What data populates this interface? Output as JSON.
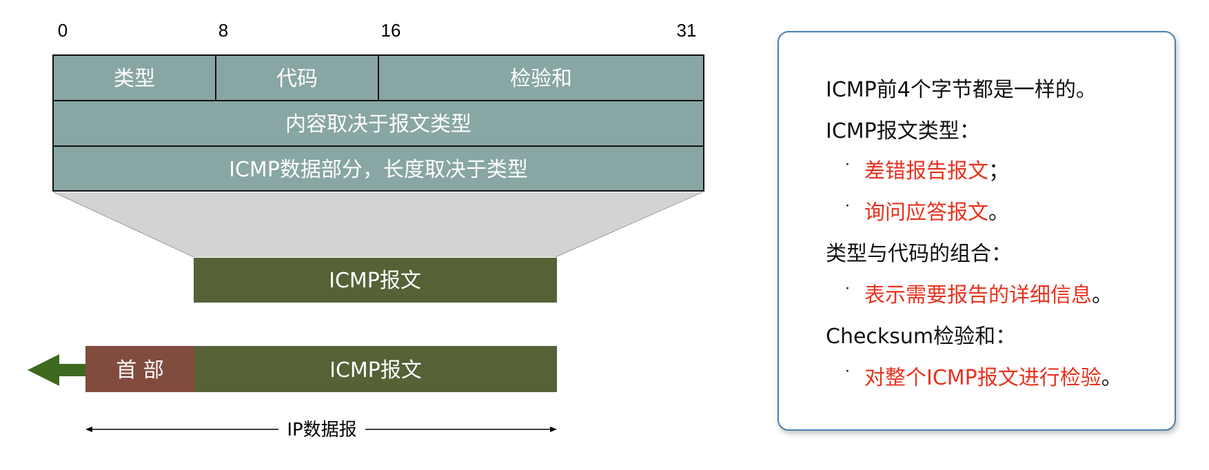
{
  "header": {
    "bits": [
      "0",
      "8",
      "16",
      "31"
    ]
  },
  "icmp_header": {
    "row1": {
      "type": "类型",
      "code": "代码",
      "checksum": "检验和"
    },
    "row2": "内容取决于报文类型",
    "row3": "ICMP数据部分，长度取决于类型"
  },
  "icmp_message_label": "ICMP报文",
  "ip_datagram": {
    "header_label": "首 部",
    "payload_label": "ICMP报文",
    "span_label": "IP数据报"
  },
  "colors": {
    "header_fill": "#88a6a3",
    "message_fill": "#546236",
    "ip_header_fill": "#814b3e",
    "funnel_fill": "#d3d3d3",
    "arrow_green": "#3d6a1f",
    "note_red": "#e8321e",
    "panel_border": "#4a7fb0"
  },
  "notes": {
    "line1": "ICMP前4个字节都是一样的。",
    "line2": "ICMP报文类型：",
    "bullet1": "差错报告报文",
    "bullet1_tail": "；",
    "bullet2": "询问应答报文",
    "bullet2_tail": "。",
    "line3": "类型与代码的组合：",
    "bullet3": "表示需要报告的详细信息",
    "bullet3_tail": "。",
    "line4": "Checksum检验和：",
    "bullet4": "对整个ICMP报文进行检验",
    "bullet4_tail": "。",
    "bullet_mark": "·"
  }
}
